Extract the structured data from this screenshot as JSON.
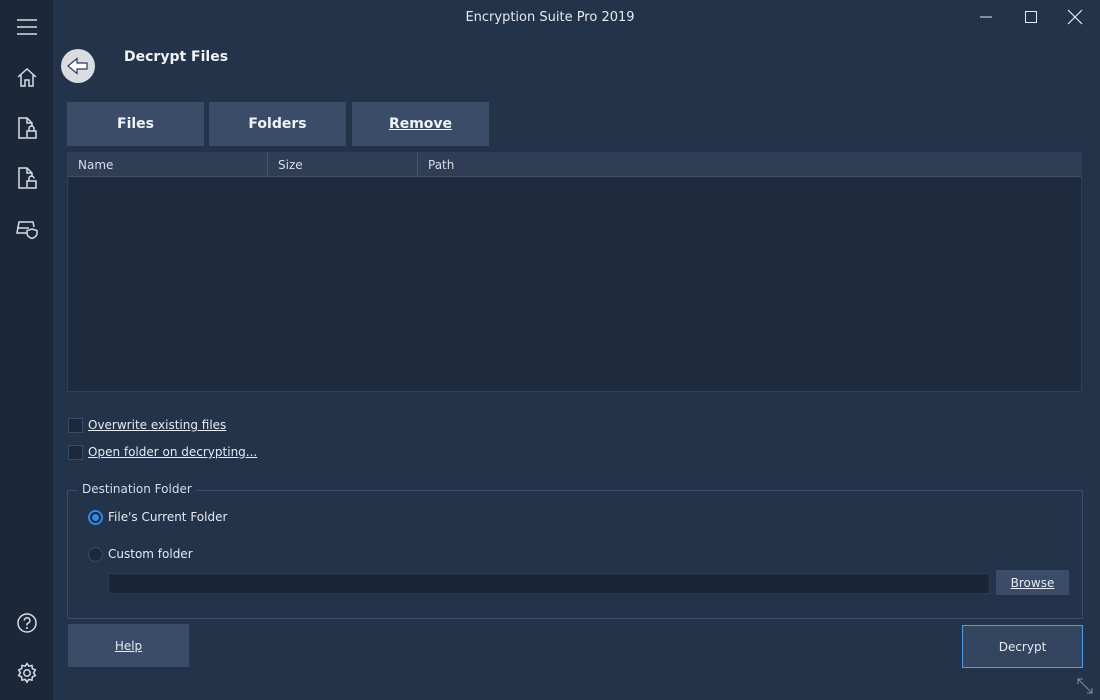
{
  "window": {
    "title": "Encryption Suite Pro 2019"
  },
  "sidebar": {
    "items": [
      {
        "icon": "menu-icon"
      },
      {
        "icon": "home-icon"
      },
      {
        "icon": "file-lock-icon"
      },
      {
        "icon": "file-unlock-icon"
      },
      {
        "icon": "drive-shield-icon"
      },
      {
        "icon": "help-icon"
      },
      {
        "icon": "gear-icon"
      }
    ]
  },
  "header": {
    "page_title": "Decrypt Files"
  },
  "toolbar": {
    "files_label": "Files",
    "folders_label": "Folders",
    "remove_label": "Remove"
  },
  "table": {
    "columns": [
      "Name",
      "Size",
      "Path"
    ],
    "rows": []
  },
  "options": {
    "overwrite_label": "Overwrite existing files",
    "overwrite_checked": false,
    "open_folder_label": "Open folder on decrypting...",
    "open_folder_checked": false
  },
  "destination": {
    "legend": "Destination Folder",
    "current_folder_label": "File's Current Folder",
    "custom_folder_label": "Custom folder",
    "selected": "current",
    "path_value": "",
    "browse_label": "Browse"
  },
  "footer": {
    "help_label": "Help",
    "decrypt_label": "Decrypt"
  },
  "colors": {
    "background": "#233349",
    "sidebar": "#1c283a",
    "button": "#3a4c68",
    "accent": "#2f8be6"
  }
}
